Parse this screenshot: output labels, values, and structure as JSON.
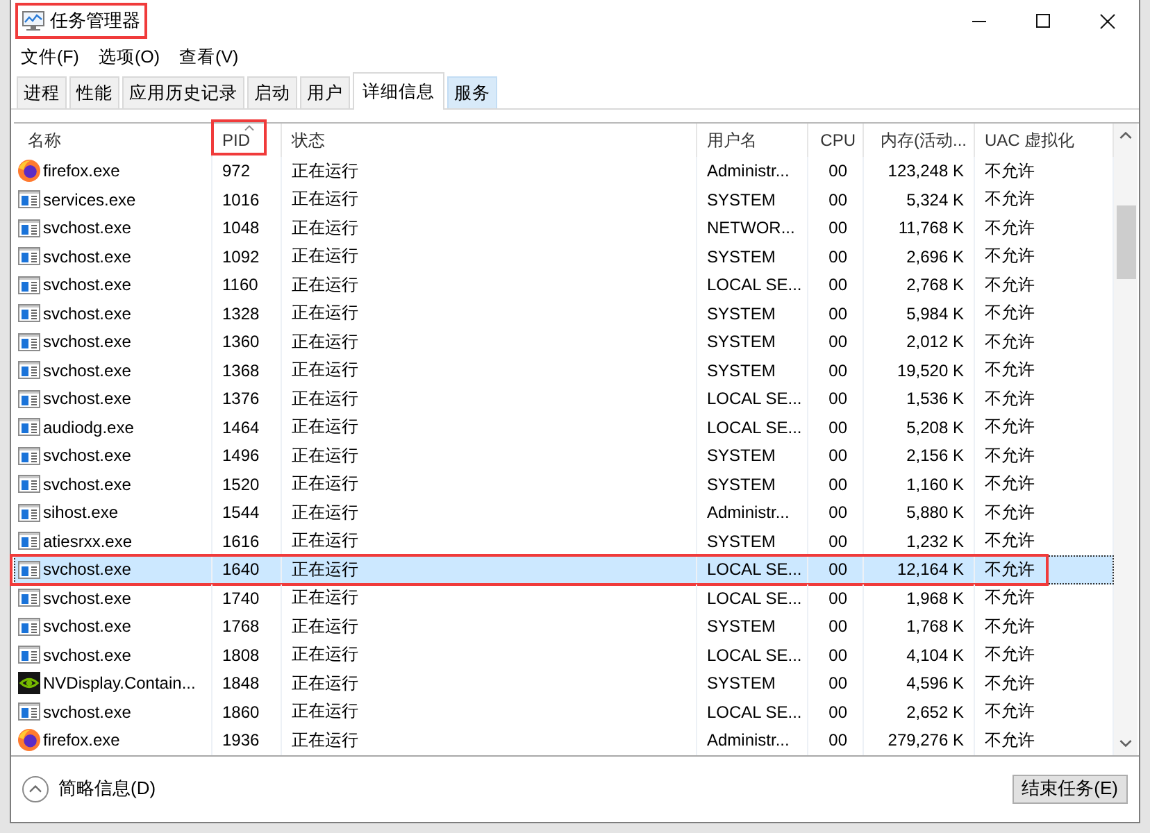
{
  "window": {
    "title": "任务管理器",
    "highlighted": true
  },
  "menu": [
    {
      "label": "文件(F)"
    },
    {
      "label": "选项(O)"
    },
    {
      "label": "查看(V)"
    }
  ],
  "tabs": [
    {
      "label": "进程",
      "selected": false,
      "hovered": false
    },
    {
      "label": "性能",
      "selected": false,
      "hovered": false
    },
    {
      "label": "应用历史记录",
      "selected": false,
      "hovered": false
    },
    {
      "label": "启动",
      "selected": false,
      "hovered": false
    },
    {
      "label": "用户",
      "selected": false,
      "hovered": false
    },
    {
      "label": "详细信息",
      "selected": true,
      "hovered": false
    },
    {
      "label": "服务",
      "selected": false,
      "hovered": true
    }
  ],
  "table": {
    "columns": [
      {
        "label": "名称",
        "sorted": false,
        "highlighted": false
      },
      {
        "label": "PID",
        "sorted": true,
        "highlighted": true
      },
      {
        "label": "状态",
        "sorted": false,
        "highlighted": false
      },
      {
        "label": "用户名",
        "sorted": false,
        "highlighted": false
      },
      {
        "label": "CPU",
        "sorted": false,
        "highlighted": false
      },
      {
        "label": "内存(活动...",
        "sorted": false,
        "highlighted": false
      },
      {
        "label": "UAC 虚拟化",
        "sorted": false,
        "highlighted": false
      }
    ],
    "rows": [
      {
        "kind": "browser",
        "name": "firefox.exe",
        "pid": "972",
        "status": "正在运行",
        "user": "Administr...",
        "cpu": "00",
        "memory": "123,248 K",
        "uac": "不允许",
        "selected": false,
        "highlighted": false
      },
      {
        "kind": "program",
        "name": "services.exe",
        "pid": "1016",
        "status": "正在运行",
        "user": "SYSTEM",
        "cpu": "00",
        "memory": "5,324 K",
        "uac": "不允许",
        "selected": false,
        "highlighted": false
      },
      {
        "kind": "program",
        "name": "svchost.exe",
        "pid": "1048",
        "status": "正在运行",
        "user": "NETWOR...",
        "cpu": "00",
        "memory": "11,768 K",
        "uac": "不允许",
        "selected": false,
        "highlighted": false
      },
      {
        "kind": "program",
        "name": "svchost.exe",
        "pid": "1092",
        "status": "正在运行",
        "user": "SYSTEM",
        "cpu": "00",
        "memory": "2,696 K",
        "uac": "不允许",
        "selected": false,
        "highlighted": false
      },
      {
        "kind": "program",
        "name": "svchost.exe",
        "pid": "1160",
        "status": "正在运行",
        "user": "LOCAL SE...",
        "cpu": "00",
        "memory": "2,768 K",
        "uac": "不允许",
        "selected": false,
        "highlighted": false
      },
      {
        "kind": "program",
        "name": "svchost.exe",
        "pid": "1328",
        "status": "正在运行",
        "user": "SYSTEM",
        "cpu": "00",
        "memory": "5,984 K",
        "uac": "不允许",
        "selected": false,
        "highlighted": false
      },
      {
        "kind": "program",
        "name": "svchost.exe",
        "pid": "1360",
        "status": "正在运行",
        "user": "SYSTEM",
        "cpu": "00",
        "memory": "2,012 K",
        "uac": "不允许",
        "selected": false,
        "highlighted": false
      },
      {
        "kind": "program",
        "name": "svchost.exe",
        "pid": "1368",
        "status": "正在运行",
        "user": "SYSTEM",
        "cpu": "00",
        "memory": "19,520 K",
        "uac": "不允许",
        "selected": false,
        "highlighted": false
      },
      {
        "kind": "program",
        "name": "svchost.exe",
        "pid": "1376",
        "status": "正在运行",
        "user": "LOCAL SE...",
        "cpu": "00",
        "memory": "1,536 K",
        "uac": "不允许",
        "selected": false,
        "highlighted": false
      },
      {
        "kind": "program",
        "name": "audiodg.exe",
        "pid": "1464",
        "status": "正在运行",
        "user": "LOCAL SE...",
        "cpu": "00",
        "memory": "5,208 K",
        "uac": "不允许",
        "selected": false,
        "highlighted": false
      },
      {
        "kind": "program",
        "name": "svchost.exe",
        "pid": "1496",
        "status": "正在运行",
        "user": "SYSTEM",
        "cpu": "00",
        "memory": "2,156 K",
        "uac": "不允许",
        "selected": false,
        "highlighted": false
      },
      {
        "kind": "program",
        "name": "svchost.exe",
        "pid": "1520",
        "status": "正在运行",
        "user": "SYSTEM",
        "cpu": "00",
        "memory": "1,160 K",
        "uac": "不允许",
        "selected": false,
        "highlighted": false
      },
      {
        "kind": "program",
        "name": "sihost.exe",
        "pid": "1544",
        "status": "正在运行",
        "user": "Administr...",
        "cpu": "00",
        "memory": "5,880 K",
        "uac": "不允许",
        "selected": false,
        "highlighted": false
      },
      {
        "kind": "program",
        "name": "atiesrxx.exe",
        "pid": "1616",
        "status": "正在运行",
        "user": "SYSTEM",
        "cpu": "00",
        "memory": "1,232 K",
        "uac": "不允许",
        "selected": false,
        "highlighted": false
      },
      {
        "kind": "program",
        "name": "svchost.exe",
        "pid": "1640",
        "status": "正在运行",
        "user": "LOCAL SE...",
        "cpu": "00",
        "memory": "12,164 K",
        "uac": "不允许",
        "selected": true,
        "highlighted": true
      },
      {
        "kind": "program",
        "name": "svchost.exe",
        "pid": "1740",
        "status": "正在运行",
        "user": "LOCAL SE...",
        "cpu": "00",
        "memory": "1,968 K",
        "uac": "不允许",
        "selected": false,
        "highlighted": false
      },
      {
        "kind": "program",
        "name": "svchost.exe",
        "pid": "1768",
        "status": "正在运行",
        "user": "SYSTEM",
        "cpu": "00",
        "memory": "1,768 K",
        "uac": "不允许",
        "selected": false,
        "highlighted": false
      },
      {
        "kind": "program",
        "name": "svchost.exe",
        "pid": "1808",
        "status": "正在运行",
        "user": "LOCAL SE...",
        "cpu": "00",
        "memory": "4,104 K",
        "uac": "不允许",
        "selected": false,
        "highlighted": false
      },
      {
        "kind": "driver",
        "name": "NVDisplay.Contain...",
        "pid": "1848",
        "status": "正在运行",
        "user": "SYSTEM",
        "cpu": "00",
        "memory": "4,596 K",
        "uac": "不允许",
        "selected": false,
        "highlighted": false
      },
      {
        "kind": "program",
        "name": "svchost.exe",
        "pid": "1860",
        "status": "正在运行",
        "user": "LOCAL SE...",
        "cpu": "00",
        "memory": "2,652 K",
        "uac": "不允许",
        "selected": false,
        "highlighted": false
      },
      {
        "kind": "browser",
        "name": "firefox.exe",
        "pid": "1936",
        "status": "正在运行",
        "user": "Administr...",
        "cpu": "00",
        "memory": "279,276 K",
        "uac": "不允许",
        "selected": false,
        "highlighted": false
      }
    ]
  },
  "footer": {
    "details_toggle": "简略信息(D)",
    "end_task_button": "结束任务(E)"
  }
}
